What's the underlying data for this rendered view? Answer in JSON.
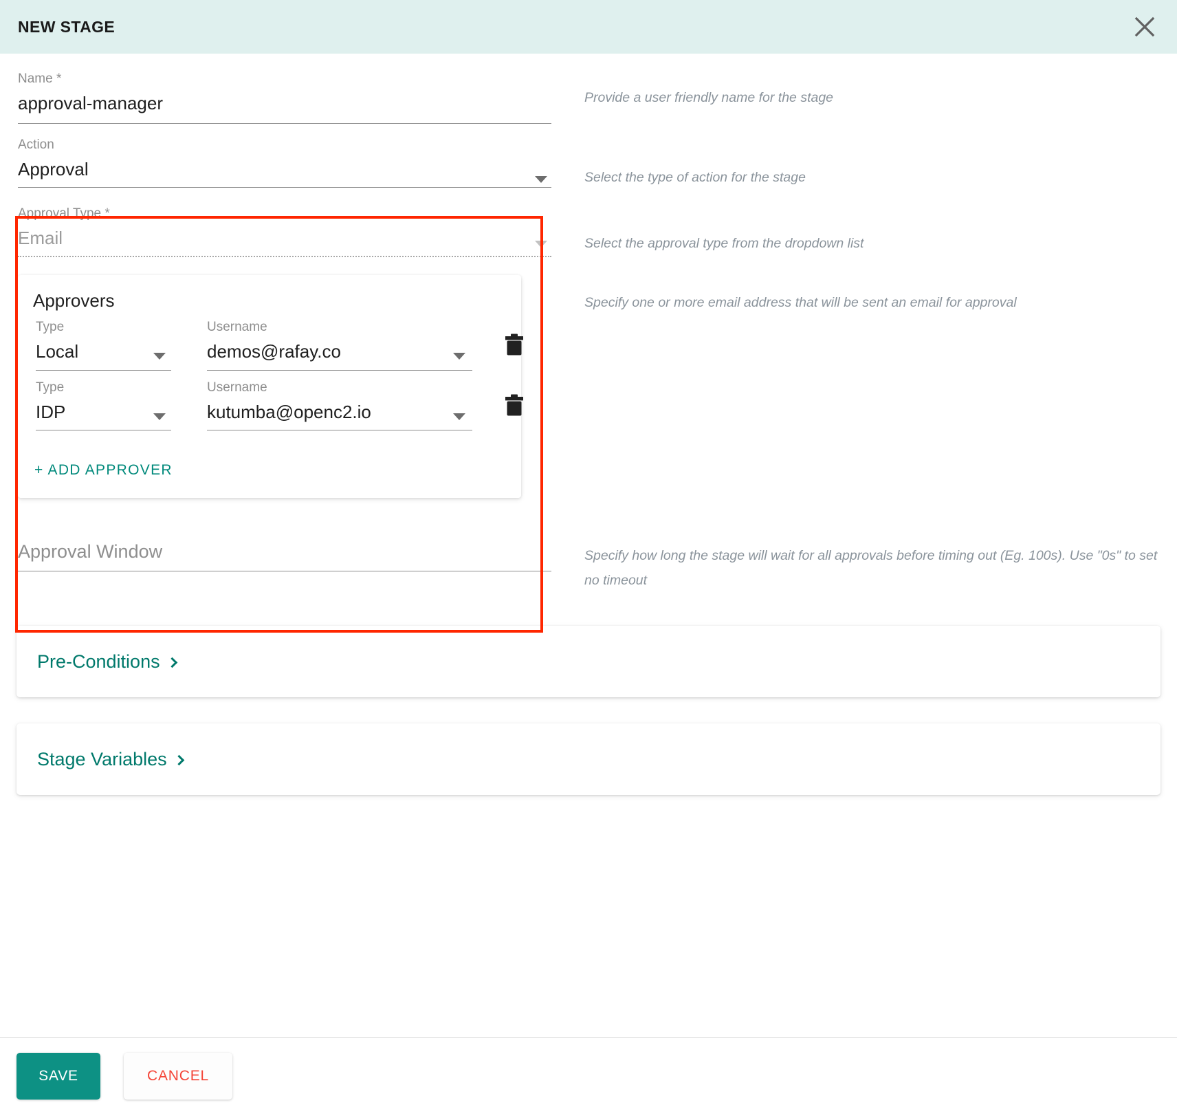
{
  "header": {
    "title": "NEW STAGE",
    "close_icon": "close-icon"
  },
  "form": {
    "name": {
      "label": "Name *",
      "value": "approval-manager",
      "hint": "Provide a user friendly name for the stage"
    },
    "action": {
      "label": "Action",
      "value": "Approval",
      "hint": "Select the type of action for the stage"
    },
    "approval_type": {
      "label": "Approval Type *",
      "value": "Email",
      "hint": "Select the approval type from the dropdown list"
    },
    "approvers": {
      "title": "Approvers",
      "hint": "Specify one or more email address that will be sent an email for approval",
      "type_label": "Type",
      "username_label": "Username",
      "delete_icon": "trash-icon",
      "rows": [
        {
          "type": "Local",
          "username": "demos@rafay.co"
        },
        {
          "type": "IDP",
          "username": "kutumba@openc2.io"
        }
      ],
      "add_label": "+ ADD  APPROVER"
    },
    "approval_window": {
      "placeholder": "Approval Window",
      "value": "",
      "hint": "Specify how long the stage will wait for all approvals before timing out (Eg. 100s). Use \"0s\" to set no timeout"
    }
  },
  "accordions": [
    {
      "label": "Pre-Conditions"
    },
    {
      "label": "Stage Variables"
    }
  ],
  "footer": {
    "save_label": "SAVE",
    "cancel_label": "CANCEL"
  },
  "colors": {
    "header_bg": "#dff0ee",
    "accent_teal": "#00796b",
    "save_green": "#0d9184",
    "cancel_red": "#f44336",
    "highlight_red": "#ff2600"
  }
}
